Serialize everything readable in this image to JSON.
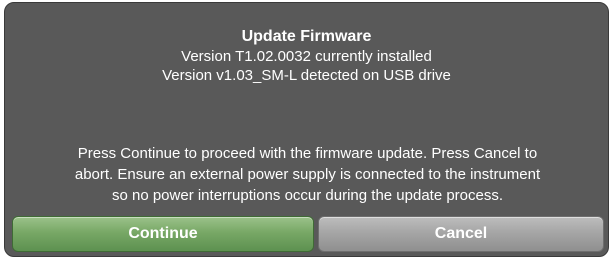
{
  "dialog": {
    "title": "Update Firmware",
    "installed_line": "Version T1.02.0032 currently installed",
    "detected_line": "Version v1.03_SM-L detected on USB drive",
    "message_lines": [
      "Press Continue to proceed with the firmware update. Press Cancel to",
      "abort. Ensure an external power supply is connected to the instrument",
      "so no power interruptions occur during the update process."
    ]
  },
  "buttons": {
    "continue_label": "Continue",
    "cancel_label": "Cancel"
  },
  "colors": {
    "dialog_background": "#595959",
    "continue_button": "#78a866",
    "cancel_button": "#a6a6a6",
    "text": "#ffffff"
  }
}
